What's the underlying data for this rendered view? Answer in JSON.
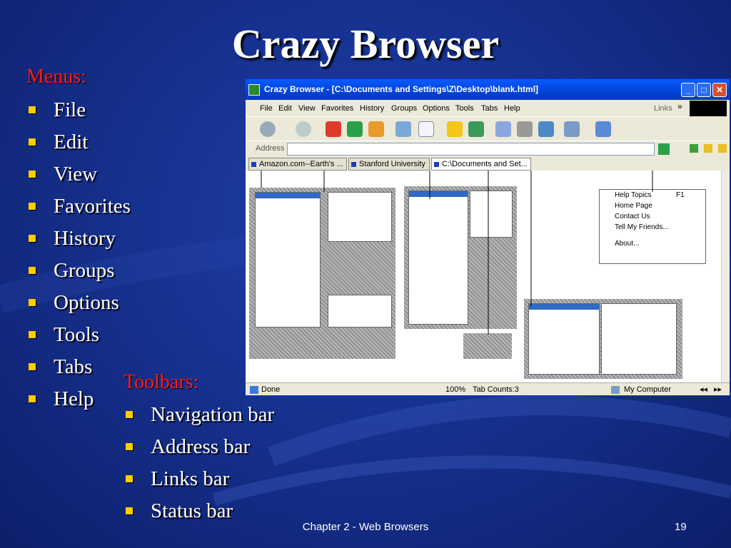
{
  "slide": {
    "title": "Crazy Browser",
    "menus_heading": "Menus:",
    "menus": [
      "File",
      "Edit",
      "View",
      "Favorites",
      "History",
      "Groups",
      "Options",
      "Tools",
      "Tabs",
      "Help"
    ],
    "toolbars_heading": "Toolbars:",
    "toolbars": [
      "Navigation bar",
      "Address bar",
      "Links bar",
      "Status bar"
    ],
    "footer_chapter": "Chapter 2 - Web Browsers",
    "page_number": "19"
  },
  "colors": {
    "background": "#16318f",
    "heading_red": "#ff1a1a",
    "bullet_yellow": "#ffcc00"
  },
  "browser": {
    "title": "Crazy Browser - [C:\\Documents and Settings\\Z\\Desktop\\blank.html]",
    "menubar": [
      "File",
      "Edit",
      "View",
      "Favorites",
      "History",
      "Groups",
      "Options",
      "Tools",
      "Tabs",
      "Help"
    ],
    "links_label": "Links",
    "address_label": "Address",
    "tabs": [
      "Amazon.com--Earth's ...",
      "Stanford University",
      "C:\\Documents and Set..."
    ],
    "status": {
      "text": "Done",
      "zoom": "100%",
      "tab_count": "Tab Counts:3",
      "zone": "My Computer"
    },
    "help_menu": [
      {
        "label": "Help Topics",
        "shortcut": "F1"
      },
      {
        "label": "Home Page",
        "shortcut": ""
      },
      {
        "label": "Contact Us",
        "shortcut": ""
      },
      {
        "label": "Tell My Friends...",
        "shortcut": ""
      },
      {
        "label": "About...",
        "shortcut": ""
      }
    ]
  }
}
